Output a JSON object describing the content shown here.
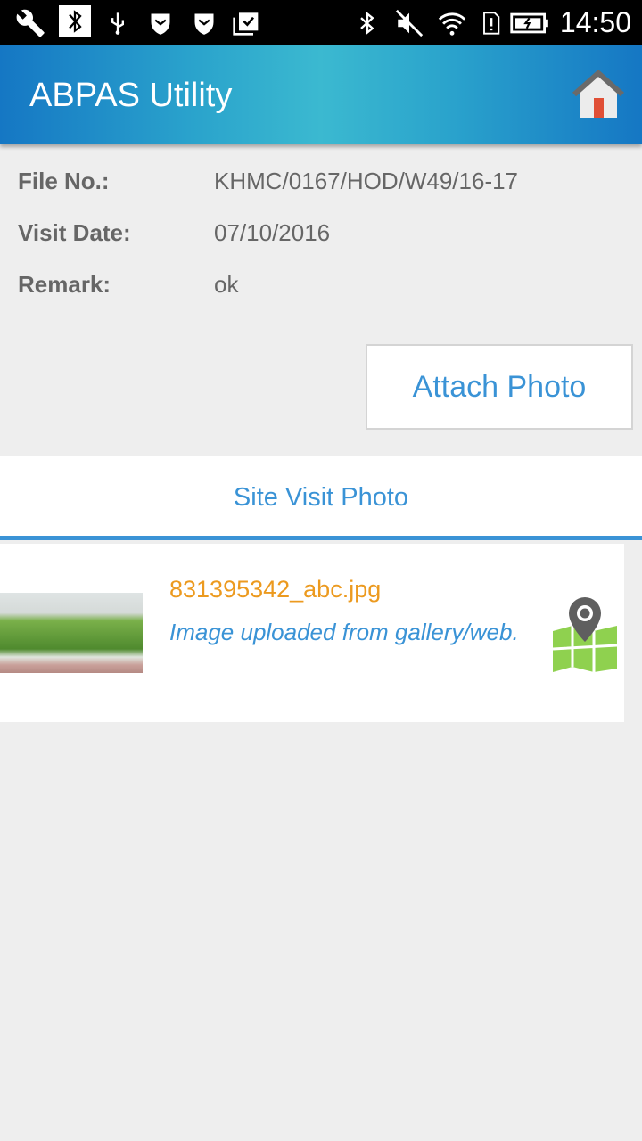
{
  "status_bar": {
    "time": "14:50",
    "icons": [
      "wrench-icon",
      "bluetooth-notification-icon",
      "usb-icon",
      "shield-icon",
      "shield-icon",
      "clipboard-check-icon",
      "bluetooth-icon",
      "vibrate-mute-icon",
      "wifi-icon",
      "sim-alert-icon",
      "battery-charging-icon"
    ]
  },
  "app_bar": {
    "title": "ABPAS Utility",
    "home_icon": "home-icon"
  },
  "details": [
    {
      "label": "File No.:",
      "value": "KHMC/0167/HOD/W49/16-17"
    },
    {
      "label": "Visit Date:",
      "value": "07/10/2016"
    },
    {
      "label": "Remark:",
      "value": "ok"
    }
  ],
  "attach_button": "Attach Photo",
  "tab": {
    "label": "Site Visit Photo",
    "accent": "#3a93d6"
  },
  "photos": [
    {
      "filename": "831395342_abc.jpg",
      "description": "Image uploaded from gallery/web.",
      "icon": "map-pin-icon"
    }
  ],
  "colors": {
    "accent": "#3a93d6",
    "filename": "#ec9a1f"
  }
}
